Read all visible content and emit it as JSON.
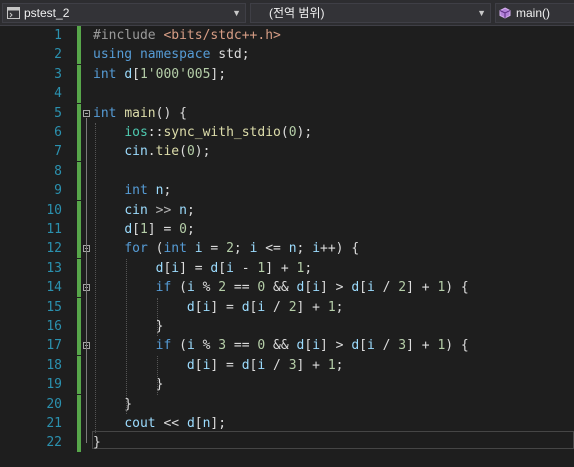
{
  "toolbar": {
    "project": "pstest_2",
    "scope": "(전역 범위)",
    "member": "main()"
  },
  "editor": {
    "lines": [
      {
        "n": "1",
        "tokens": [
          {
            "t": "#include",
            "c": "pp"
          },
          {
            "t": " ",
            "c": "txt"
          },
          {
            "t": "<bits/stdc++.h>",
            "c": "str"
          }
        ]
      },
      {
        "n": "2",
        "tokens": [
          {
            "t": "using",
            "c": "kw"
          },
          {
            "t": " ",
            "c": "txt"
          },
          {
            "t": "namespace",
            "c": "kw"
          },
          {
            "t": " std;",
            "c": "txt"
          }
        ]
      },
      {
        "n": "3",
        "tokens": [
          {
            "t": "int",
            "c": "kw"
          },
          {
            "t": " ",
            "c": "txt"
          },
          {
            "t": "d",
            "c": "var"
          },
          {
            "t": "[",
            "c": "txt"
          },
          {
            "t": "1'000'005",
            "c": "num"
          },
          {
            "t": "];",
            "c": "txt"
          }
        ]
      },
      {
        "n": "4",
        "tokens": []
      },
      {
        "n": "5",
        "tokens": [
          {
            "t": "int",
            "c": "kw"
          },
          {
            "t": " ",
            "c": "txt"
          },
          {
            "t": "main",
            "c": "fn"
          },
          {
            "t": "() {",
            "c": "txt"
          }
        ]
      },
      {
        "n": "6",
        "tokens": [
          {
            "t": "    ",
            "c": "txt"
          },
          {
            "t": "ios",
            "c": "ns"
          },
          {
            "t": "::",
            "c": "txt"
          },
          {
            "t": "sync_with_stdio",
            "c": "fn"
          },
          {
            "t": "(",
            "c": "txt"
          },
          {
            "t": "0",
            "c": "num"
          },
          {
            "t": ");",
            "c": "txt"
          }
        ]
      },
      {
        "n": "7",
        "tokens": [
          {
            "t": "    ",
            "c": "txt"
          },
          {
            "t": "cin",
            "c": "var"
          },
          {
            "t": ".",
            "c": "txt"
          },
          {
            "t": "tie",
            "c": "fn"
          },
          {
            "t": "(",
            "c": "txt"
          },
          {
            "t": "0",
            "c": "num"
          },
          {
            "t": ");",
            "c": "txt"
          }
        ]
      },
      {
        "n": "8",
        "tokens": []
      },
      {
        "n": "9",
        "tokens": [
          {
            "t": "    ",
            "c": "txt"
          },
          {
            "t": "int",
            "c": "kw"
          },
          {
            "t": " ",
            "c": "txt"
          },
          {
            "t": "n",
            "c": "var"
          },
          {
            "t": ";",
            "c": "txt"
          }
        ]
      },
      {
        "n": "10",
        "tokens": [
          {
            "t": "    ",
            "c": "txt"
          },
          {
            "t": "cin",
            "c": "var"
          },
          {
            "t": " ",
            "c": "txt"
          },
          {
            "t": ">>",
            "c": "op"
          },
          {
            "t": " ",
            "c": "txt"
          },
          {
            "t": "n",
            "c": "var"
          },
          {
            "t": ";",
            "c": "txt"
          }
        ]
      },
      {
        "n": "11",
        "tokens": [
          {
            "t": "    ",
            "c": "txt"
          },
          {
            "t": "d",
            "c": "var"
          },
          {
            "t": "[",
            "c": "txt"
          },
          {
            "t": "1",
            "c": "num"
          },
          {
            "t": "] = ",
            "c": "txt"
          },
          {
            "t": "0",
            "c": "num"
          },
          {
            "t": ";",
            "c": "txt"
          }
        ]
      },
      {
        "n": "12",
        "tokens": [
          {
            "t": "    ",
            "c": "txt"
          },
          {
            "t": "for",
            "c": "kw"
          },
          {
            "t": " (",
            "c": "txt"
          },
          {
            "t": "int",
            "c": "kw"
          },
          {
            "t": " ",
            "c": "txt"
          },
          {
            "t": "i",
            "c": "var"
          },
          {
            "t": " = ",
            "c": "txt"
          },
          {
            "t": "2",
            "c": "num"
          },
          {
            "t": "; ",
            "c": "txt"
          },
          {
            "t": "i",
            "c": "var"
          },
          {
            "t": " <= ",
            "c": "txt"
          },
          {
            "t": "n",
            "c": "var"
          },
          {
            "t": "; ",
            "c": "txt"
          },
          {
            "t": "i",
            "c": "var"
          },
          {
            "t": "++) {",
            "c": "txt"
          }
        ]
      },
      {
        "n": "13",
        "tokens": [
          {
            "t": "        ",
            "c": "txt"
          },
          {
            "t": "d",
            "c": "var"
          },
          {
            "t": "[",
            "c": "txt"
          },
          {
            "t": "i",
            "c": "var"
          },
          {
            "t": "] = ",
            "c": "txt"
          },
          {
            "t": "d",
            "c": "var"
          },
          {
            "t": "[",
            "c": "txt"
          },
          {
            "t": "i",
            "c": "var"
          },
          {
            "t": " - ",
            "c": "txt"
          },
          {
            "t": "1",
            "c": "num"
          },
          {
            "t": "] + ",
            "c": "txt"
          },
          {
            "t": "1",
            "c": "num"
          },
          {
            "t": ";",
            "c": "txt"
          }
        ]
      },
      {
        "n": "14",
        "tokens": [
          {
            "t": "        ",
            "c": "txt"
          },
          {
            "t": "if",
            "c": "kw"
          },
          {
            "t": " (",
            "c": "txt"
          },
          {
            "t": "i",
            "c": "var"
          },
          {
            "t": " % ",
            "c": "txt"
          },
          {
            "t": "2",
            "c": "num"
          },
          {
            "t": " == ",
            "c": "txt"
          },
          {
            "t": "0",
            "c": "num"
          },
          {
            "t": " && ",
            "c": "txt"
          },
          {
            "t": "d",
            "c": "var"
          },
          {
            "t": "[",
            "c": "txt"
          },
          {
            "t": "i",
            "c": "var"
          },
          {
            "t": "] > ",
            "c": "txt"
          },
          {
            "t": "d",
            "c": "var"
          },
          {
            "t": "[",
            "c": "txt"
          },
          {
            "t": "i",
            "c": "var"
          },
          {
            "t": " / ",
            "c": "txt"
          },
          {
            "t": "2",
            "c": "num"
          },
          {
            "t": "] + ",
            "c": "txt"
          },
          {
            "t": "1",
            "c": "num"
          },
          {
            "t": ") {",
            "c": "txt"
          }
        ]
      },
      {
        "n": "15",
        "tokens": [
          {
            "t": "            ",
            "c": "txt"
          },
          {
            "t": "d",
            "c": "var"
          },
          {
            "t": "[",
            "c": "txt"
          },
          {
            "t": "i",
            "c": "var"
          },
          {
            "t": "] = ",
            "c": "txt"
          },
          {
            "t": "d",
            "c": "var"
          },
          {
            "t": "[",
            "c": "txt"
          },
          {
            "t": "i",
            "c": "var"
          },
          {
            "t": " / ",
            "c": "txt"
          },
          {
            "t": "2",
            "c": "num"
          },
          {
            "t": "] + ",
            "c": "txt"
          },
          {
            "t": "1",
            "c": "num"
          },
          {
            "t": ";",
            "c": "txt"
          }
        ]
      },
      {
        "n": "16",
        "tokens": [
          {
            "t": "        }",
            "c": "txt"
          }
        ]
      },
      {
        "n": "17",
        "tokens": [
          {
            "t": "        ",
            "c": "txt"
          },
          {
            "t": "if",
            "c": "kw"
          },
          {
            "t": " (",
            "c": "txt"
          },
          {
            "t": "i",
            "c": "var"
          },
          {
            "t": " % ",
            "c": "txt"
          },
          {
            "t": "3",
            "c": "num"
          },
          {
            "t": " == ",
            "c": "txt"
          },
          {
            "t": "0",
            "c": "num"
          },
          {
            "t": " && ",
            "c": "txt"
          },
          {
            "t": "d",
            "c": "var"
          },
          {
            "t": "[",
            "c": "txt"
          },
          {
            "t": "i",
            "c": "var"
          },
          {
            "t": "] > ",
            "c": "txt"
          },
          {
            "t": "d",
            "c": "var"
          },
          {
            "t": "[",
            "c": "txt"
          },
          {
            "t": "i",
            "c": "var"
          },
          {
            "t": " / ",
            "c": "txt"
          },
          {
            "t": "3",
            "c": "num"
          },
          {
            "t": "] + ",
            "c": "txt"
          },
          {
            "t": "1",
            "c": "num"
          },
          {
            "t": ") {",
            "c": "txt"
          }
        ]
      },
      {
        "n": "18",
        "tokens": [
          {
            "t": "            ",
            "c": "txt"
          },
          {
            "t": "d",
            "c": "var"
          },
          {
            "t": "[",
            "c": "txt"
          },
          {
            "t": "i",
            "c": "var"
          },
          {
            "t": "] = ",
            "c": "txt"
          },
          {
            "t": "d",
            "c": "var"
          },
          {
            "t": "[",
            "c": "txt"
          },
          {
            "t": "i",
            "c": "var"
          },
          {
            "t": " / ",
            "c": "txt"
          },
          {
            "t": "3",
            "c": "num"
          },
          {
            "t": "] + ",
            "c": "txt"
          },
          {
            "t": "1",
            "c": "num"
          },
          {
            "t": ";",
            "c": "txt"
          }
        ]
      },
      {
        "n": "19",
        "tokens": [
          {
            "t": "        }",
            "c": "txt"
          }
        ]
      },
      {
        "n": "20",
        "tokens": [
          {
            "t": "    }",
            "c": "txt"
          }
        ]
      },
      {
        "n": "21",
        "tokens": [
          {
            "t": "    ",
            "c": "txt"
          },
          {
            "t": "cout",
            "c": "var"
          },
          {
            "t": " << ",
            "c": "txt"
          },
          {
            "t": "d",
            "c": "var"
          },
          {
            "t": "[",
            "c": "txt"
          },
          {
            "t": "n",
            "c": "var"
          },
          {
            "t": "];",
            "c": "txt"
          }
        ]
      },
      {
        "n": "22",
        "tokens": [
          {
            "t": "}",
            "c": "txt"
          }
        ]
      }
    ]
  }
}
